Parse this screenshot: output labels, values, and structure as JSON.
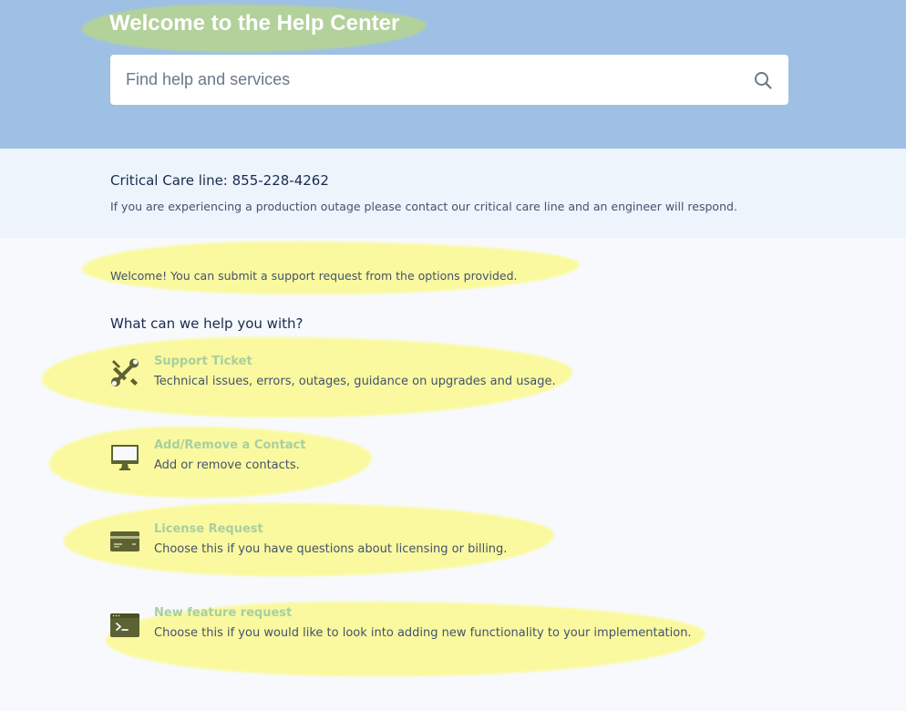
{
  "header": {
    "title": "Welcome to the Help Center"
  },
  "search": {
    "placeholder": "Find help and services",
    "value": ""
  },
  "critical_care": {
    "title": "Critical Care line: 855-228-4262",
    "description": "If you are experiencing a production outage please contact our critical care line and an engineer will respond."
  },
  "welcome_message": "Welcome! You can submit a support request from the options provided.",
  "help_heading": "What can we help you with?",
  "request_types": [
    {
      "title": "Support Ticket",
      "description": "Technical issues, errors, outages, guidance on upgrades and usage.",
      "icon": "wrench-screwdriver-icon"
    },
    {
      "title": "Add/Remove a Contact",
      "description": "Add or remove contacts.",
      "icon": "monitor-icon"
    },
    {
      "title": "License Request",
      "description": "Choose this if you have questions about licensing or billing.",
      "icon": "credit-card-icon"
    },
    {
      "title": "New feature request",
      "description": "Choose this if you would like to look into adding new functionality to your implementation.",
      "icon": "terminal-icon"
    }
  ],
  "colors": {
    "header_background": "#9dc0e4",
    "critical_background": "#eef4fc",
    "page_background": "#f7f9fc",
    "option_title": "#a8cfa0",
    "icon_color": "#5d6232",
    "highlight": "#fbfa8f"
  }
}
